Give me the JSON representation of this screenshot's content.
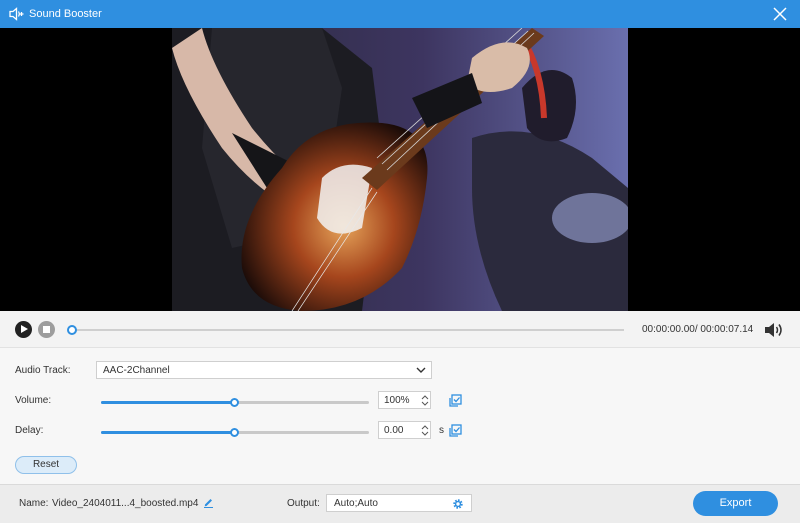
{
  "window": {
    "title": "Sound Booster",
    "accent_color": "#2f8fe0"
  },
  "player": {
    "current_time": "00:00:00.00",
    "total_time": "00:00:07.14",
    "time_separator": "/ ",
    "progress_fraction": 0.0,
    "preview_description": "Video frame: guitarist playing a sunburst electric bass on stage"
  },
  "settings": {
    "audio_track": {
      "label": "Audio Track:",
      "value": "AAC-2Channel"
    },
    "volume": {
      "label": "Volume:",
      "value": "100%",
      "slider_fraction": 0.5
    },
    "delay": {
      "label": "Delay:",
      "value": "0.00",
      "unit": "s",
      "slider_fraction": 0.5
    },
    "reset_label": "Reset"
  },
  "footer": {
    "name_label": "Name:",
    "file_name": "Video_2404011...4_boosted.mp4",
    "output_label": "Output:",
    "output_value": "Auto;Auto",
    "export_label": "Export"
  },
  "icons": {
    "app": "speaker-plus-icon",
    "close": "close-icon",
    "volume": "volume-icon",
    "edit": "pencil-icon",
    "settings": "gear-icon",
    "apply_all": "apply-to-all-icon"
  }
}
